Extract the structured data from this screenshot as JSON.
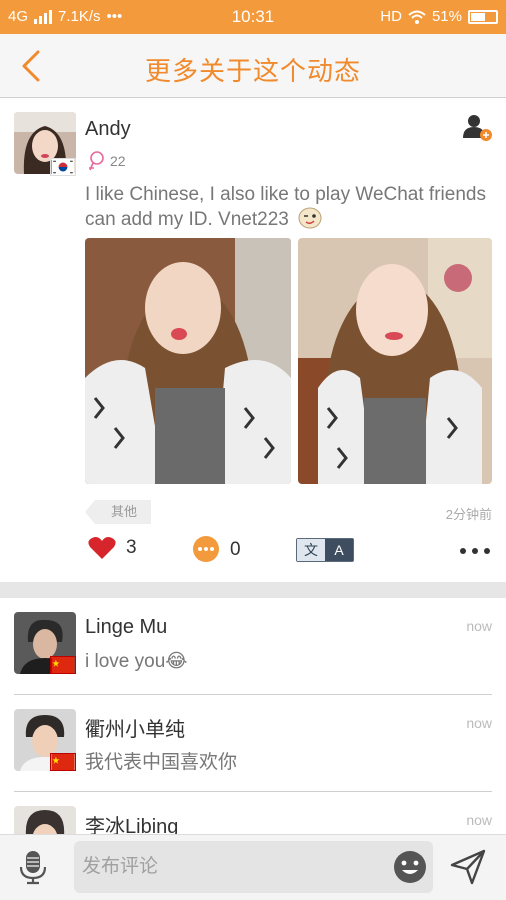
{
  "status_bar": {
    "network": "4G",
    "speed": "7.1K/s",
    "dots": "•••",
    "time": "10:31",
    "hd": "HD",
    "battery": "51%"
  },
  "header": {
    "title": "更多关于这个动态",
    "accent_color": "#f08a2c"
  },
  "post": {
    "author": "Andy",
    "age": "22",
    "text": "I like Chinese, I also like to play WeChat friends can add my ID.   Vnet223",
    "tag": "其他",
    "time": "2分钟前",
    "likes": "3",
    "comments": "0",
    "translate_left": "文",
    "translate_right": "A"
  },
  "comments": [
    {
      "name": "Linge Mu",
      "text": "i love you😂",
      "when": "now"
    },
    {
      "name": "衢州小单纯",
      "text": "我代表中国喜欢你",
      "when": "now"
    },
    {
      "name": "李冰Libing",
      "text": "",
      "when": "now"
    }
  ],
  "composer": {
    "placeholder": "发布评论"
  }
}
